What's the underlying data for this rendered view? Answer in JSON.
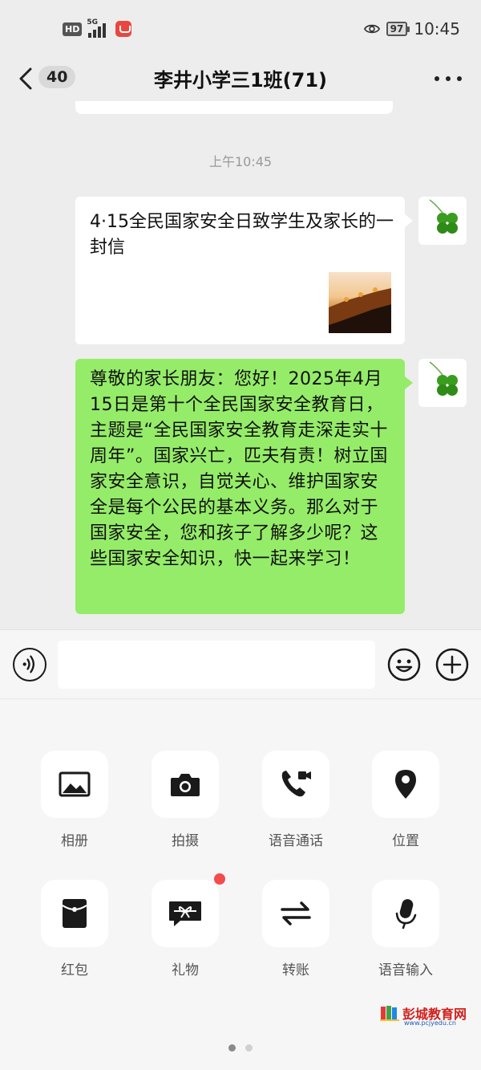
{
  "status_bar": {
    "hd": "HD",
    "network": "5G",
    "battery": "97",
    "time": "10:45"
  },
  "header": {
    "unread_count": "40",
    "title": "李井小学三1班(71)"
  },
  "chat": {
    "timestamp": "上午10:45",
    "messages": [
      {
        "type": "link-card",
        "title": "4·15全民国家安全日致学生及家长的一封信"
      },
      {
        "type": "text",
        "text": "尊敬的家长朋友：您好！2025年4月15日是第十个全民国家安全教育日，主题是“全民国家安全教育走深走实十周年”。国家兴亡，匹夫有责！树立国家安全意识，自觉关心、维护国家安全是每个公民的基本义务。那么对于国家安全，您和孩子了解多少呢？这些国家安全知识，快一起来学习！"
      }
    ]
  },
  "input": {
    "value": "",
    "placeholder": ""
  },
  "panel": {
    "tiles": [
      {
        "label": "相册",
        "icon": "image-icon"
      },
      {
        "label": "拍摄",
        "icon": "camera-icon"
      },
      {
        "label": "语音通话",
        "icon": "phone-video-icon"
      },
      {
        "label": "位置",
        "icon": "location-icon"
      },
      {
        "label": "红包",
        "icon": "red-packet-icon"
      },
      {
        "label": "礼物",
        "icon": "gift-icon"
      },
      {
        "label": "转账",
        "icon": "transfer-icon"
      },
      {
        "label": "语音输入",
        "icon": "microphone-icon"
      }
    ],
    "gift_has_badge": true,
    "page_count": 2,
    "current_page": 1
  },
  "watermark": {
    "name": "彭城教育网",
    "url": "www.pcjyedu.cn"
  },
  "colors": {
    "background": "#ededed",
    "sent_bubble": "#95ec69",
    "card_bubble": "#ffffff",
    "badge_red": "#f24c4c",
    "watermark_red": "#d0211c"
  }
}
